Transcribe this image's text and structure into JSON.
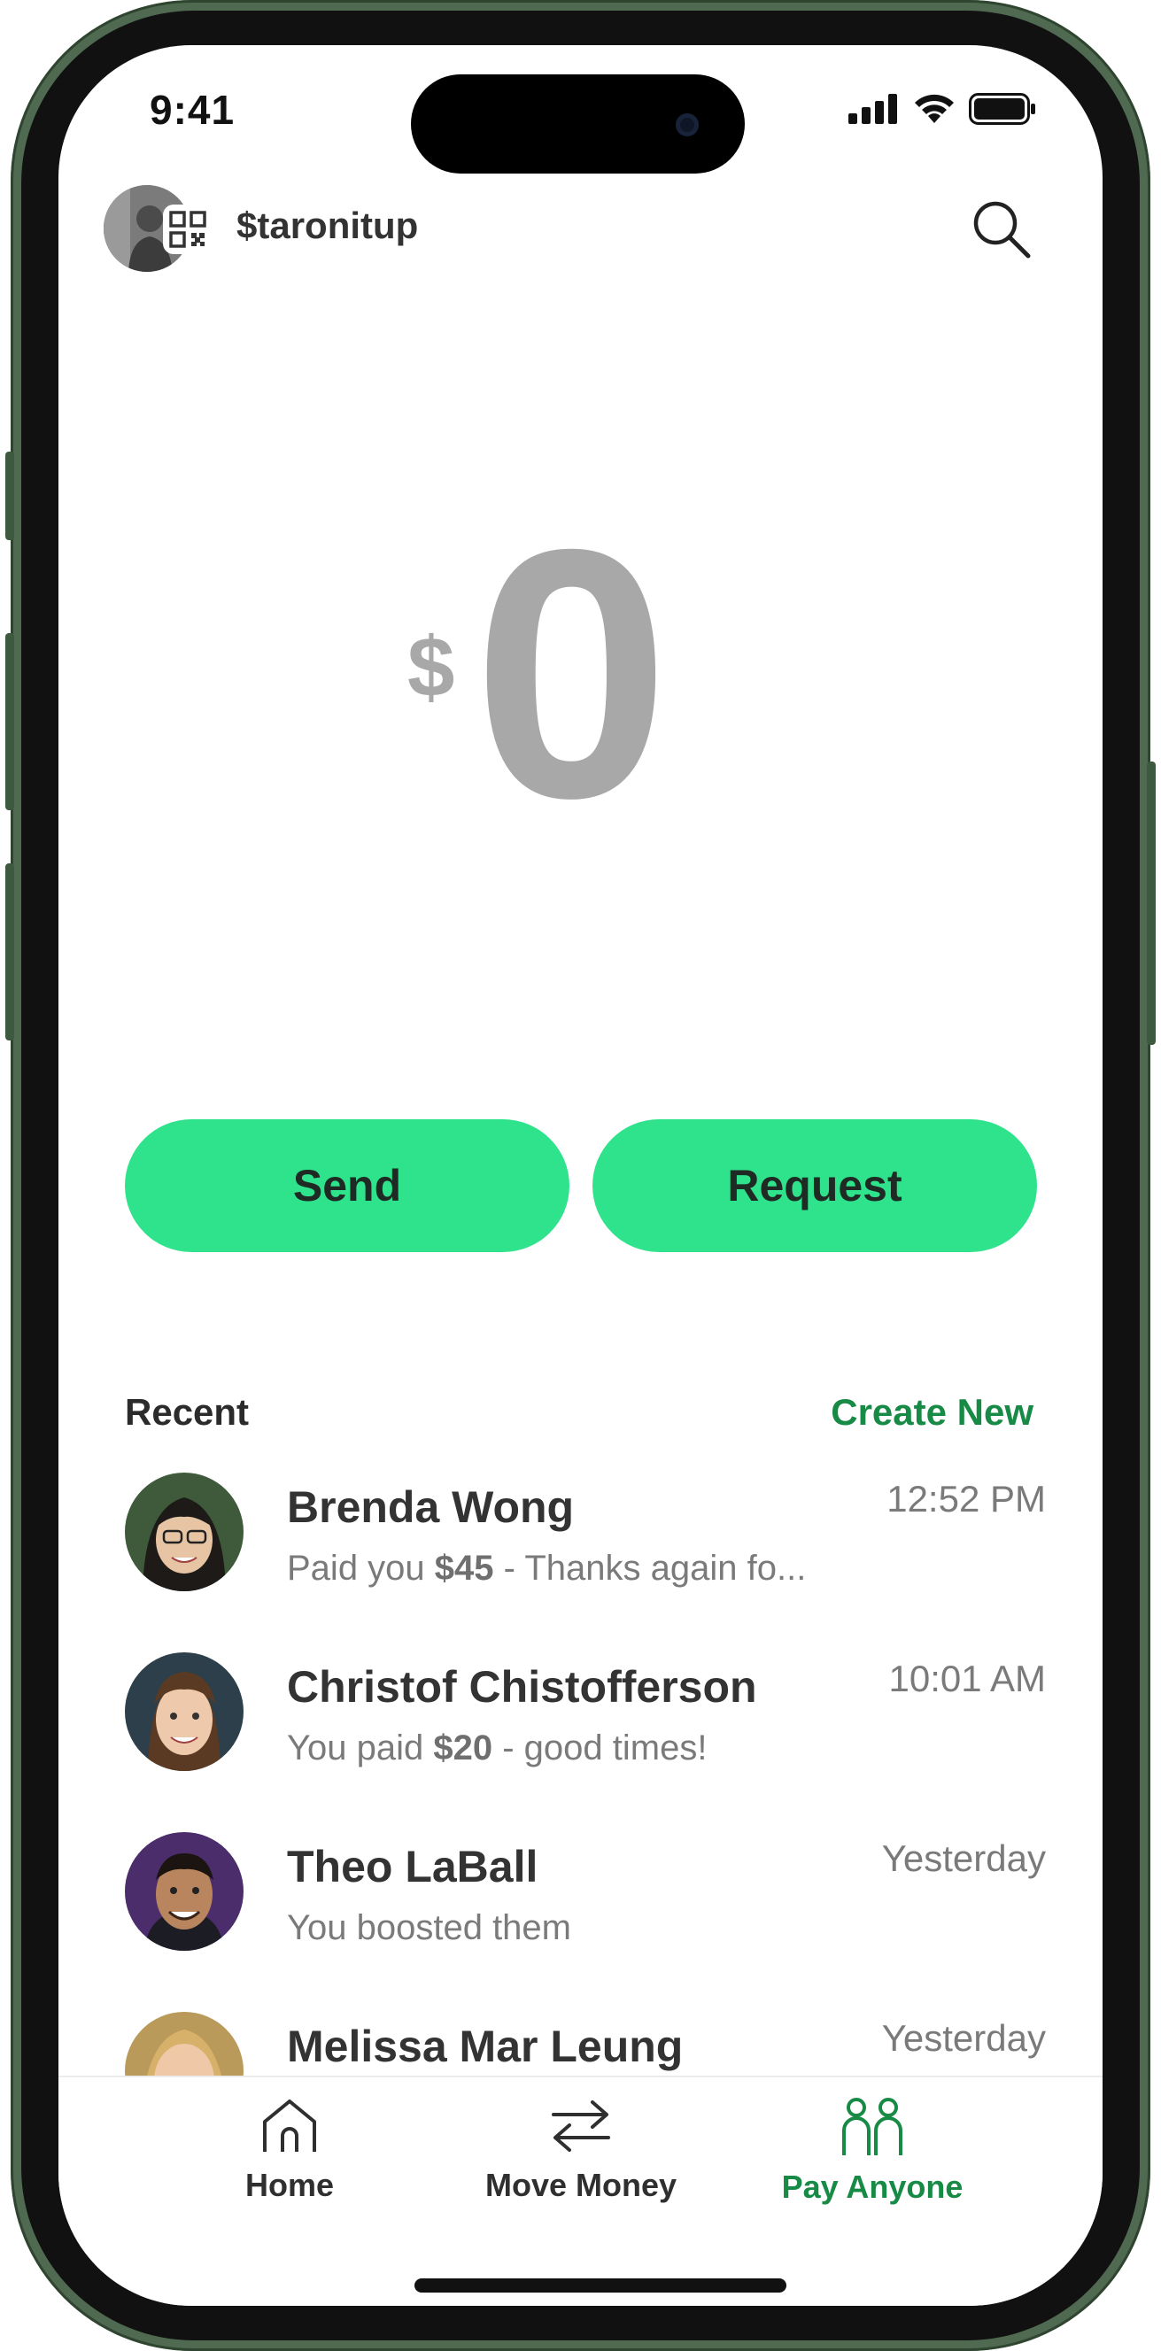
{
  "status": {
    "time": "9:41"
  },
  "header": {
    "handle": "$taronitup"
  },
  "amount": {
    "currency": "$",
    "value": "0"
  },
  "actions": {
    "send_label": "Send",
    "request_label": "Request"
  },
  "recent": {
    "title": "Recent",
    "create_new": "Create New",
    "items": [
      {
        "name": "Brenda Wong",
        "sub_prefix": "Paid you ",
        "sub_amount": "$45",
        "sub_suffix": " - Thanks again fo...",
        "time": "12:52 PM"
      },
      {
        "name": "Christof Chistofferson",
        "sub_prefix": "You paid ",
        "sub_amount": "$20",
        "sub_suffix": " - good times!",
        "time": "10:01 AM"
      },
      {
        "name": "Theo LaBall",
        "sub_prefix": "You boosted them",
        "sub_amount": "",
        "sub_suffix": "",
        "time": "Yesterday"
      },
      {
        "name": "Melissa Mar Leung",
        "sub_prefix": "",
        "sub_amount": "",
        "sub_suffix": "",
        "time": "Yesterday"
      }
    ]
  },
  "tabs": [
    {
      "label": "Home",
      "icon": "home-icon",
      "active": false
    },
    {
      "label": "Move Money",
      "icon": "transfer-arrows-icon",
      "active": false
    },
    {
      "label": "Pay Anyone",
      "icon": "people-icon",
      "active": true
    }
  ],
  "colors": {
    "accent_green": "#2fe38d",
    "link_green": "#178a46",
    "frame_green": "#4f6a50",
    "amount_gray": "#a8a8a8"
  }
}
